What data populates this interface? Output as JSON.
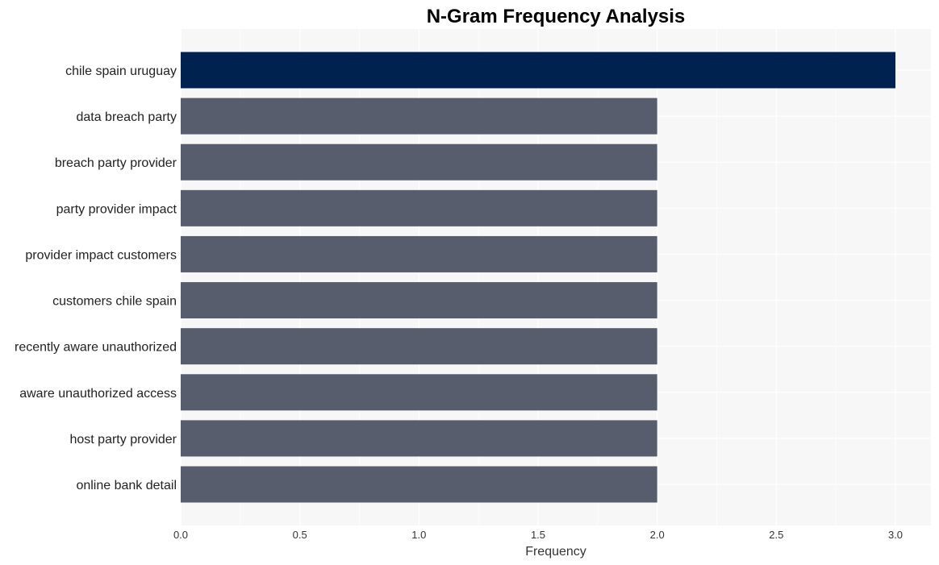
{
  "chart_data": {
    "type": "bar",
    "orientation": "horizontal",
    "title": "N-Gram Frequency Analysis",
    "xlabel": "Frequency",
    "ylabel": "",
    "categories": [
      "chile spain uruguay",
      "data breach party",
      "breach party provider",
      "party provider impact",
      "provider impact customers",
      "customers chile spain",
      "recently aware unauthorized",
      "aware unauthorized access",
      "host party provider",
      "online bank detail"
    ],
    "values": [
      3,
      2,
      2,
      2,
      2,
      2,
      2,
      2,
      2,
      2
    ],
    "xlim": [
      0,
      3.15
    ],
    "xticks": [
      0.0,
      0.5,
      1.0,
      1.5,
      2.0,
      2.5,
      3.0
    ],
    "xtick_labels": [
      "0.0",
      "0.5",
      "1.0",
      "1.5",
      "2.0",
      "2.5",
      "3.0"
    ],
    "grid": true,
    "colors": {
      "highlight": "#00224e",
      "default": "#575d6d",
      "plot_background": "#f7f7f7",
      "grid": "#ffffff"
    }
  }
}
